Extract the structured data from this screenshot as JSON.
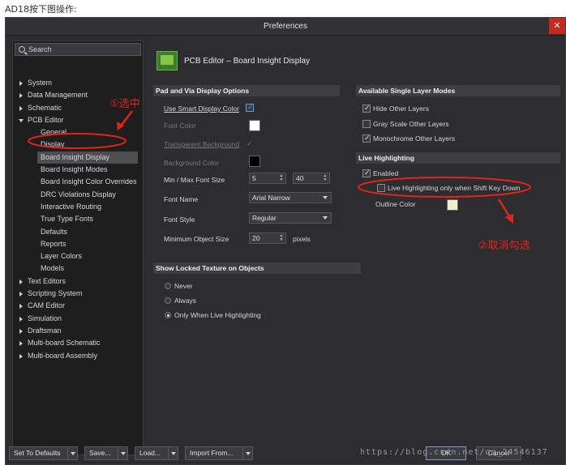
{
  "caption": "AD18按下图操作:",
  "window": {
    "title": "Preferences",
    "close_glyph": "✕"
  },
  "search": {
    "label": "Search"
  },
  "tree": {
    "top_items_before": [
      "System",
      "Data Management",
      "Schematic"
    ],
    "pcb_editor": "PCB Editor",
    "pcb_children": [
      "General",
      "Display",
      "Board Insight Display",
      "Board Insight Modes",
      "Board Insight Color Overrides",
      "DRC Violations Display",
      "Interactive Routing",
      "True Type Fonts",
      "Defaults",
      "Reports",
      "Layer Colors",
      "Models"
    ],
    "top_items_after": [
      "Text Editors",
      "Scripting System",
      "CAM Editor",
      "Simulation",
      "Draftsman",
      "Multi-board Schematic",
      "Multi-board Assembly"
    ],
    "selected": "Board Insight Display"
  },
  "header": {
    "title": "PCB Editor – Board Insight Display",
    "icon": "pcb-board-icon"
  },
  "pad_via": {
    "heading": "Pad and Via Display Options",
    "smart_color_label": "Use Smart Display Color",
    "smart_color_checked": true,
    "font_color_label": "Font Color",
    "font_color": "#ffffff",
    "transparent_bg_label": "Transparent Background",
    "bg_color_label": "Background Color",
    "bg_color": "#000000",
    "font_size_label": "Min / Max Font Size",
    "min_font": "5",
    "max_font": "40",
    "font_name_label": "Font Name",
    "font_name": "Arial Narrow",
    "font_style_label": "Font Style",
    "font_style": "Regular",
    "min_obj_label": "Minimum Object Size",
    "min_obj": "20",
    "min_obj_unit": "pixels"
  },
  "locked": {
    "heading": "Show Locked Texture on Objects",
    "options": [
      "Never",
      "Always",
      "Only When Live Highlighting"
    ],
    "selected": "Only When Live Highlighting"
  },
  "single_layer": {
    "heading": "Available Single Layer Modes",
    "options": [
      {
        "label": "Hide Other Layers",
        "checked": true
      },
      {
        "label": "Gray Scale Other Layers",
        "checked": false
      },
      {
        "label": "Monochrome Other Layers",
        "checked": true
      }
    ]
  },
  "live": {
    "heading": "Live Highlighting",
    "enabled_label": "Enabled",
    "enabled_checked": true,
    "shift_label": "Live Highlighting only when Shift Key Down",
    "shift_checked": false,
    "outline_label": "Outline Color",
    "outline_color": "#f2f0cc"
  },
  "buttons": {
    "defaults": "Set To Defaults",
    "save": "Save...",
    "load": "Load...",
    "import": "Import From...",
    "ok": "OK",
    "cancel": "Cancel"
  },
  "annotations": {
    "select": "①选中",
    "uncheck": "②取消勾选",
    "color": "#e0251b"
  },
  "watermark": "https://blog.csdn.net/qq_24546137"
}
